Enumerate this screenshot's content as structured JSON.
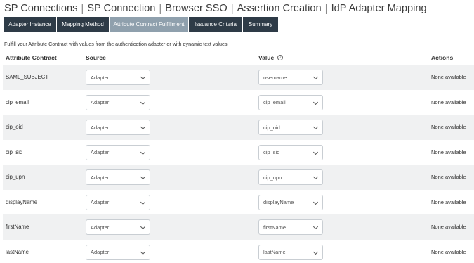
{
  "breadcrumb": [
    "SP Connections",
    "SP Connection",
    "Browser SSO",
    "Assertion Creation",
    "IdP Adapter Mapping"
  ],
  "breadcrumb_separator": "|",
  "tabs": [
    {
      "label": "Adapter Instance",
      "active": false
    },
    {
      "label": "Mapping Method",
      "active": false
    },
    {
      "label": "Attribute Contract Fulfillment",
      "active": true
    },
    {
      "label": "Issuance Criteria",
      "active": false
    },
    {
      "label": "Summary",
      "active": false
    }
  ],
  "instructions": "Fulfill your Attribute Contract with values from the authentication adapter or with dynamic text values.",
  "table": {
    "headers": {
      "attribute_contract": "Attribute Contract",
      "source": "Source",
      "value": "Value",
      "actions": "Actions"
    },
    "value_help_icon": "?",
    "rows": [
      {
        "attribute": "SAML_SUBJECT",
        "source": "Adapter",
        "value": "username",
        "actions": "None available"
      },
      {
        "attribute": "cip_email",
        "source": "Adapter",
        "value": "cip_email",
        "actions": "None available"
      },
      {
        "attribute": "cip_oid",
        "source": "Adapter",
        "value": "cip_oid",
        "actions": "None available"
      },
      {
        "attribute": "cip_sid",
        "source": "Adapter",
        "value": "cip_sid",
        "actions": "None available"
      },
      {
        "attribute": "cip_upn",
        "source": "Adapter",
        "value": "cip_upn",
        "actions": "None available"
      },
      {
        "attribute": "displayName",
        "source": "Adapter",
        "value": "displayName",
        "actions": "None available"
      },
      {
        "attribute": "firstName",
        "source": "Adapter",
        "value": "firstName",
        "actions": "None available"
      },
      {
        "attribute": "lastName",
        "source": "Adapter",
        "value": "lastName",
        "actions": "None available"
      }
    ]
  },
  "colors": {
    "tab_bg": "#2e3b47",
    "tab_active_bg": "#8fa0ad",
    "row_shade": "#f0f1f2"
  },
  "icons": {
    "help": "help-circle-icon",
    "dropdown": "chevron-down-icon"
  }
}
